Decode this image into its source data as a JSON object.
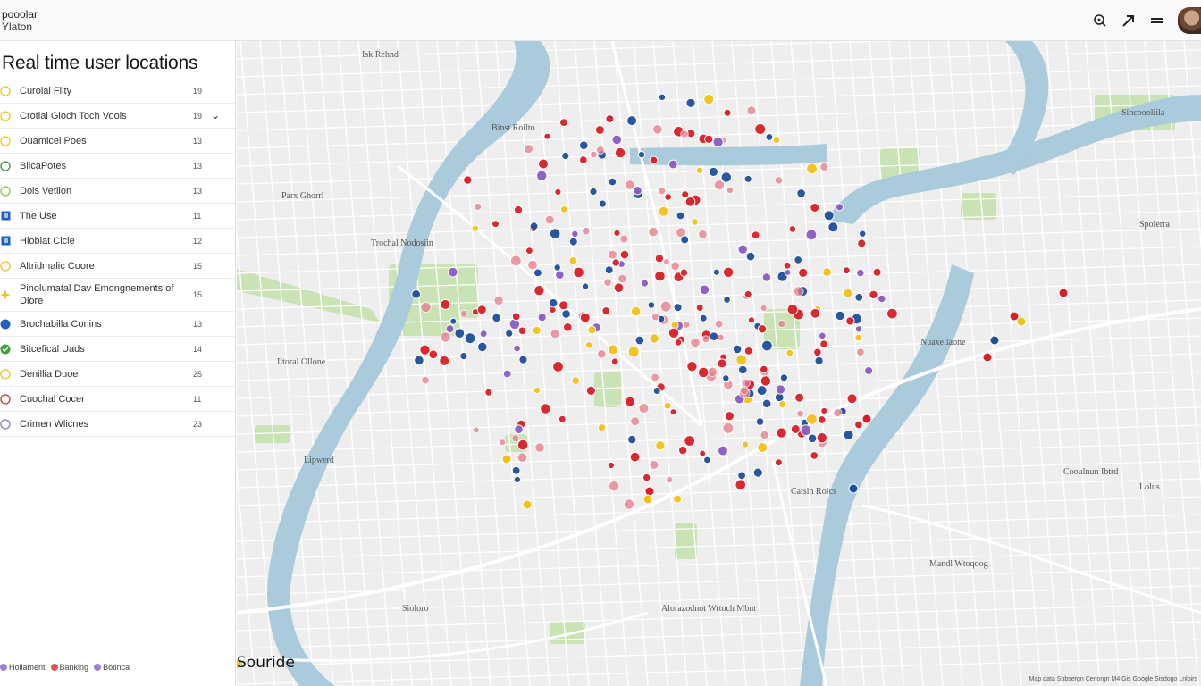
{
  "header": {
    "brand_line1": "pooolar",
    "brand_line2": "Ylaton",
    "icons": [
      "search-target-icon",
      "pointer-arrow-icon",
      "menu-icon",
      "user-avatar"
    ]
  },
  "sidebar": {
    "title": "Real time user locations",
    "items": [
      {
        "label": "Curoial Fllty",
        "count": "19",
        "color": "#f1c21b",
        "marker": "circle-outline"
      },
      {
        "label": "Crotial Gloch Toch Vools",
        "count": "19",
        "color": "#f1c21b",
        "marker": "circle-outline",
        "expanded": true
      },
      {
        "label": "Ouamicel Poes",
        "count": "13",
        "color": "#f1c21b",
        "marker": "circle-outline"
      },
      {
        "label": "BlicaPotes",
        "count": "13",
        "color": "#3f8f3f",
        "marker": "circle-outline"
      },
      {
        "label": "Dols Vetlion",
        "count": "13",
        "color": "#8cc63f",
        "marker": "circle-outline"
      },
      {
        "label": "The Use",
        "count": "11",
        "color": "#1f5fbf",
        "marker": "square"
      },
      {
        "label": "Hlobiat Clcle",
        "count": "12",
        "color": "#1f5fbf",
        "marker": "square"
      },
      {
        "label": "Altridmalic Coore",
        "count": "15",
        "color": "#f1c21b",
        "marker": "circle-outline"
      },
      {
        "label": "Pinolumatal Dav Emongnements of Dlore",
        "count": "15",
        "color": "#f1c21b",
        "marker": "star"
      },
      {
        "label": "Brochabilla Conins",
        "count": "13",
        "color": "#1f5fbf",
        "marker": "circle"
      },
      {
        "label": "Bitcefical Uads",
        "count": "14",
        "color": "#3f9f3f",
        "marker": "check"
      },
      {
        "label": "Denillia Duoe",
        "count": "25",
        "color": "#f1c21b",
        "marker": "circle-outline"
      },
      {
        "label": "Cuochal Cocer",
        "count": "11",
        "color": "#cc3333",
        "marker": "circle-outline"
      },
      {
        "label": "Crimen Wlicnes",
        "count": "23",
        "color": "#8877cc",
        "marker": "circle-outline"
      }
    ],
    "legend": [
      {
        "label": "Holiament",
        "color": "#9b7fd0"
      },
      {
        "label": "Banking",
        "color": "#e05555"
      },
      {
        "label": "Botinca",
        "color": "#9b7fd0"
      }
    ]
  },
  "map": {
    "labels": [
      "Isk Rehnd",
      "Binst Roilto",
      "Sincoooliila",
      "Trochal Nodosiin",
      "Parx Ghorrl",
      "Iltoral Ollone",
      "Catsin Rolcs",
      "Lipwerd",
      "Nuaxellaone",
      "Lolus",
      "Alorazodnot Wrtoch Mbnt",
      "Sioloro",
      "Cooulnun Ibtrd",
      "Mandl Wtoqoog",
      "Spolerra"
    ],
    "corner_label": "Souride",
    "attribution": "Map data Sobsergn Cenorgn   M4 Gis Google Sisdogo Lnloirs",
    "colors": {
      "water": "#aacbdc",
      "park": "#c9e3b5",
      "land": "#eeeeee",
      "road": "#ffffff"
    },
    "markers": {
      "red": "#d81f26",
      "blue": "#1f4e9c",
      "yellow": "#f2c119",
      "purple": "#8a5cc4",
      "pink": "#e87a8a"
    }
  }
}
